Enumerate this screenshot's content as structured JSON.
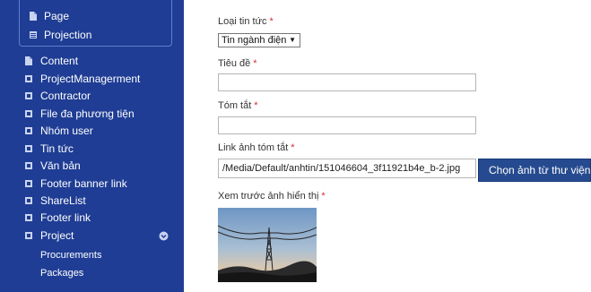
{
  "sidebar": {
    "submenu": [
      {
        "label": "Page",
        "icon": "document-icon"
      },
      {
        "label": "Projection",
        "icon": "list-icon"
      }
    ],
    "items": [
      {
        "label": "Content",
        "icon": "document-icon"
      },
      {
        "label": "ProjectManagerment",
        "icon": "square-icon"
      },
      {
        "label": "Contractor",
        "icon": "square-icon"
      },
      {
        "label": "File đa phương tiện",
        "icon": "square-icon"
      },
      {
        "label": "Nhóm user",
        "icon": "square-icon"
      },
      {
        "label": "Tin tức",
        "icon": "square-icon"
      },
      {
        "label": "Văn bản",
        "icon": "square-icon"
      },
      {
        "label": "Footer banner link",
        "icon": "square-icon"
      },
      {
        "label": "ShareList",
        "icon": "square-icon"
      },
      {
        "label": "Footer link",
        "icon": "square-icon"
      },
      {
        "label": "Project",
        "icon": "square-icon",
        "expanded": true
      }
    ],
    "project_children": [
      {
        "label": "Procurements"
      },
      {
        "label": "Packages"
      }
    ],
    "colors": {
      "background": "#1f3d94",
      "text": "#ffffff"
    }
  },
  "form": {
    "category": {
      "label": "Loại tin tức",
      "required_mark": "*",
      "selected": "Tin ngành điện"
    },
    "title": {
      "label": "Tiêu đề",
      "required_mark": "*",
      "value": ""
    },
    "summary": {
      "label": "Tóm tắt",
      "required_mark": "*",
      "value": ""
    },
    "image_link": {
      "label": "Link ảnh tóm tắt",
      "required_mark": "*",
      "value": "/Media/Default/anhtin/151046604_3f11921b4e_b-2.jpg"
    },
    "choose_button": {
      "label": "Chọn ảnh từ thư viện"
    },
    "preview": {
      "label": "Xem trước ảnh hiển thị",
      "required_mark": "*"
    }
  },
  "colors": {
    "accent_button": "#264a8f",
    "required": "#d32f2f"
  }
}
